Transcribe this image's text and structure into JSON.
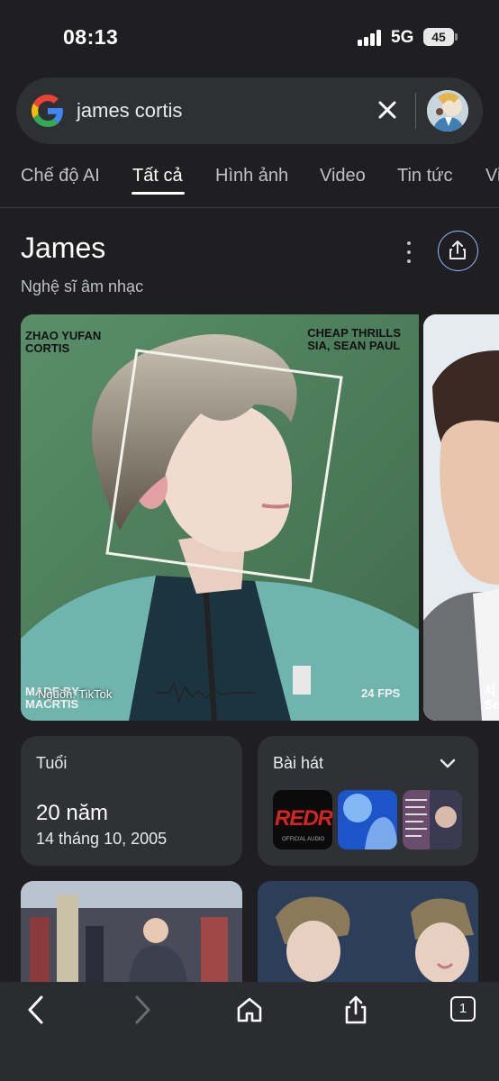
{
  "status_bar": {
    "time": "08:13",
    "network": "5G",
    "battery": "45"
  },
  "search": {
    "query": "james cortis",
    "logo": "google-g-icon"
  },
  "tabs": [
    {
      "label": "Chế độ AI"
    },
    {
      "label": "Tất cả",
      "active": true
    },
    {
      "label": "Hình ảnh"
    },
    {
      "label": "Video"
    },
    {
      "label": "Tin tức"
    },
    {
      "label": "Vi"
    }
  ],
  "entity": {
    "title": "James",
    "subtitle": "Nghệ sĩ âm nhạc"
  },
  "hero_image": {
    "poster_top_left": "ZHAO YUFAN\nCORTIS",
    "poster_top_right": "CHEAP THRILLS\nSIA, SEAN PAUL",
    "poster_bottom_left": "MADE BY\nMACRTIS",
    "poster_bottom_right": "24 FPS",
    "source": "Nguồn: TikTok",
    "side_partial_text": "서\nSe"
  },
  "age_card": {
    "label": "Tuổi",
    "value": "20 năm",
    "date": "14 tháng 10, 2005"
  },
  "songs_card": {
    "label": "Bài hát",
    "covers": [
      {
        "text": "REDRE",
        "caption": "OFFICIAL AUDIO"
      },
      {
        "text": ""
      },
      {
        "text": ""
      }
    ]
  },
  "colors": {
    "background": "#1f1f21",
    "card": "#303134",
    "accent": "#8ab4f8"
  },
  "toolbar": {
    "tab_count": "1"
  }
}
